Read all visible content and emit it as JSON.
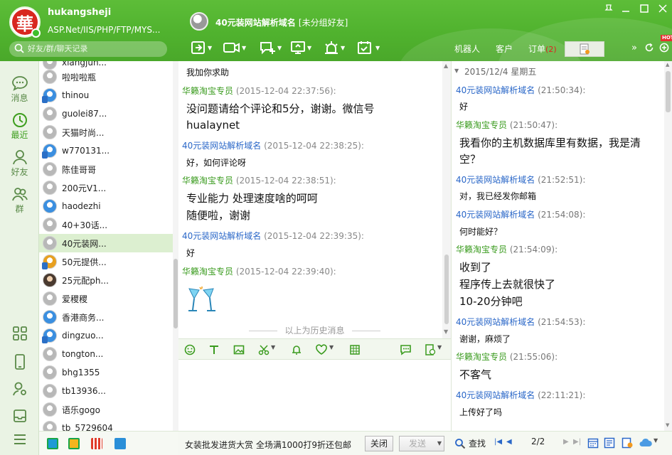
{
  "user": {
    "name": "hukangsheji",
    "signature": "ASP.Net/IIS/PHP/FTP/MYS...",
    "avatar_char": "華",
    "search_placeholder": "好友/群/聊天记录"
  },
  "chat_header": {
    "name": "40元装网站解析域名",
    "group": "[未分组好友]"
  },
  "right_tabs": [
    {
      "label": "机器人"
    },
    {
      "label": "客户"
    },
    {
      "label": "订单",
      "badge": "(2)"
    }
  ],
  "left_nav": [
    {
      "label": "消息"
    },
    {
      "label": "最近"
    },
    {
      "label": "好友"
    },
    {
      "label": "群"
    }
  ],
  "hot_badge": "HOT",
  "contacts": [
    {
      "name": "xiangjun..."
    },
    {
      "name": "啦啦啦瓶"
    },
    {
      "name": "thinou"
    },
    {
      "name": "guolei87..."
    },
    {
      "name": "天猫时尚..."
    },
    {
      "name": "w770131..."
    },
    {
      "name": "陈佳哥哥"
    },
    {
      "name": "200元V1..."
    },
    {
      "name": "haodezhi"
    },
    {
      "name": "40+30话..."
    },
    {
      "name": "40元装网..."
    },
    {
      "name": "50元提供..."
    },
    {
      "name": "25元配ph..."
    },
    {
      "name": "爱稷稷"
    },
    {
      "name": "香港商务..."
    },
    {
      "name": "dingzuo..."
    },
    {
      "name": "tongton..."
    },
    {
      "name": "bhg1355"
    },
    {
      "name": "tb13936..."
    },
    {
      "name": "语乐gogo"
    },
    {
      "name": "tb_5729604"
    }
  ],
  "chat": {
    "top_partial": "我加你求助",
    "messages": [
      {
        "sender": "华籁淘宝专员",
        "time": "(2015-12-04 22:37:56):",
        "lines": [
          "没问题请给个评论和5分，谢谢。微信号",
          "hualaynet"
        ]
      },
      {
        "sender": "40元装网站解析域名",
        "time": "(2015-12-04 22:38:25):",
        "lines": [
          "好，如何评论呀"
        ]
      },
      {
        "sender": "华籁淘宝专员",
        "time": "(2015-12-04 22:38:51):",
        "lines": [
          "专业能力 处理速度啥的呵呵",
          "随便啦，谢谢"
        ]
      },
      {
        "sender": "40元装网站解析域名",
        "time": "(2015-12-04 22:39:35):",
        "lines": [
          "好"
        ]
      },
      {
        "sender": "华籁淘宝专员",
        "time": "(2015-12-04 22:39:40):",
        "lines": []
      }
    ],
    "history_divider": "以上为历史消息"
  },
  "bottom": {
    "ad_text": "女装批发进货大赏  全场满1000打9折还包邮",
    "close_label": "关闭",
    "send_label": "发送"
  },
  "history": {
    "date": "2015/12/4 星期五",
    "messages": [
      {
        "sender": "40元装网站解析域名",
        "time": "(21:50:34):",
        "lines": [
          "好"
        ]
      },
      {
        "sender": "华籁淘宝专员",
        "time": "(21:50:47):",
        "lines": [
          "我看你的主机数据库里有数据，我是清",
          "空？"
        ]
      },
      {
        "sender": "40元装网站解析域名",
        "time": "(21:52:51):",
        "lines": [
          "对，我已经发你邮箱"
        ]
      },
      {
        "sender": "40元装网站解析域名",
        "time": "(21:54:08):",
        "lines": [
          "何时能好？"
        ]
      },
      {
        "sender": "华籁淘宝专员",
        "time": "(21:54:09):",
        "lines": [
          "收到了",
          "程序传上去就很快了",
          "10-20分钟吧"
        ]
      },
      {
        "sender": "40元装网站解析域名",
        "time": "(21:54:53):",
        "lines": [
          "谢谢，麻烦了"
        ]
      },
      {
        "sender": "华籁淘宝专员",
        "time": "(21:55:06):",
        "lines": [
          "不客气"
        ]
      },
      {
        "sender": "40元装网站解析域名",
        "time": "(22:11:21):",
        "lines": [
          "上传好了吗"
        ]
      }
    ],
    "search_label": "查找",
    "page": "2/2"
  }
}
